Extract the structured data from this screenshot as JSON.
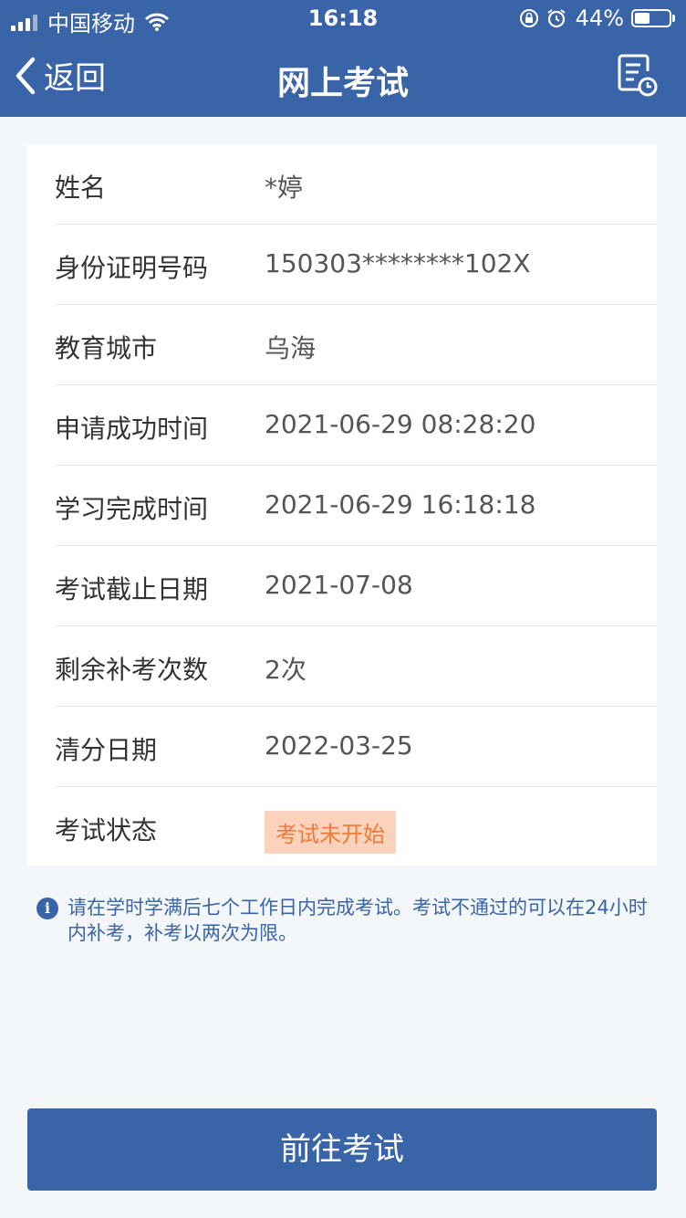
{
  "status_bar": {
    "carrier": "中国移动",
    "time": "16:18",
    "battery_percent": "44%",
    "battery_level": 0.44
  },
  "nav": {
    "back_label": "返回",
    "title": "网上考试"
  },
  "details": {
    "rows": [
      {
        "label": "姓名",
        "value": "*婷"
      },
      {
        "label": "身份证明号码",
        "value": "150303********102X"
      },
      {
        "label": "教育城市",
        "value": "乌海"
      },
      {
        "label": "申请成功时间",
        "value": "2021-06-29 08:28:20"
      },
      {
        "label": "学习完成时间",
        "value": "2021-06-29 16:18:18"
      },
      {
        "label": "考试截止日期",
        "value": "2021-07-08"
      },
      {
        "label": "剩余补考次数",
        "value": "2次"
      },
      {
        "label": "清分日期",
        "value": "2022-03-25"
      },
      {
        "label": "考试状态",
        "status": "考试未开始"
      }
    ]
  },
  "notice": {
    "icon": "info-icon",
    "text": "请在学时学满后七个工作日内完成考试。考试不通过的可以在24小时内补考，补考以两次为限。"
  },
  "action": {
    "button_label": "前往考试"
  },
  "colors": {
    "primary": "#3a64a8",
    "status_badge_bg": "#fbd3bd",
    "status_badge_text": "#f07b3a"
  }
}
